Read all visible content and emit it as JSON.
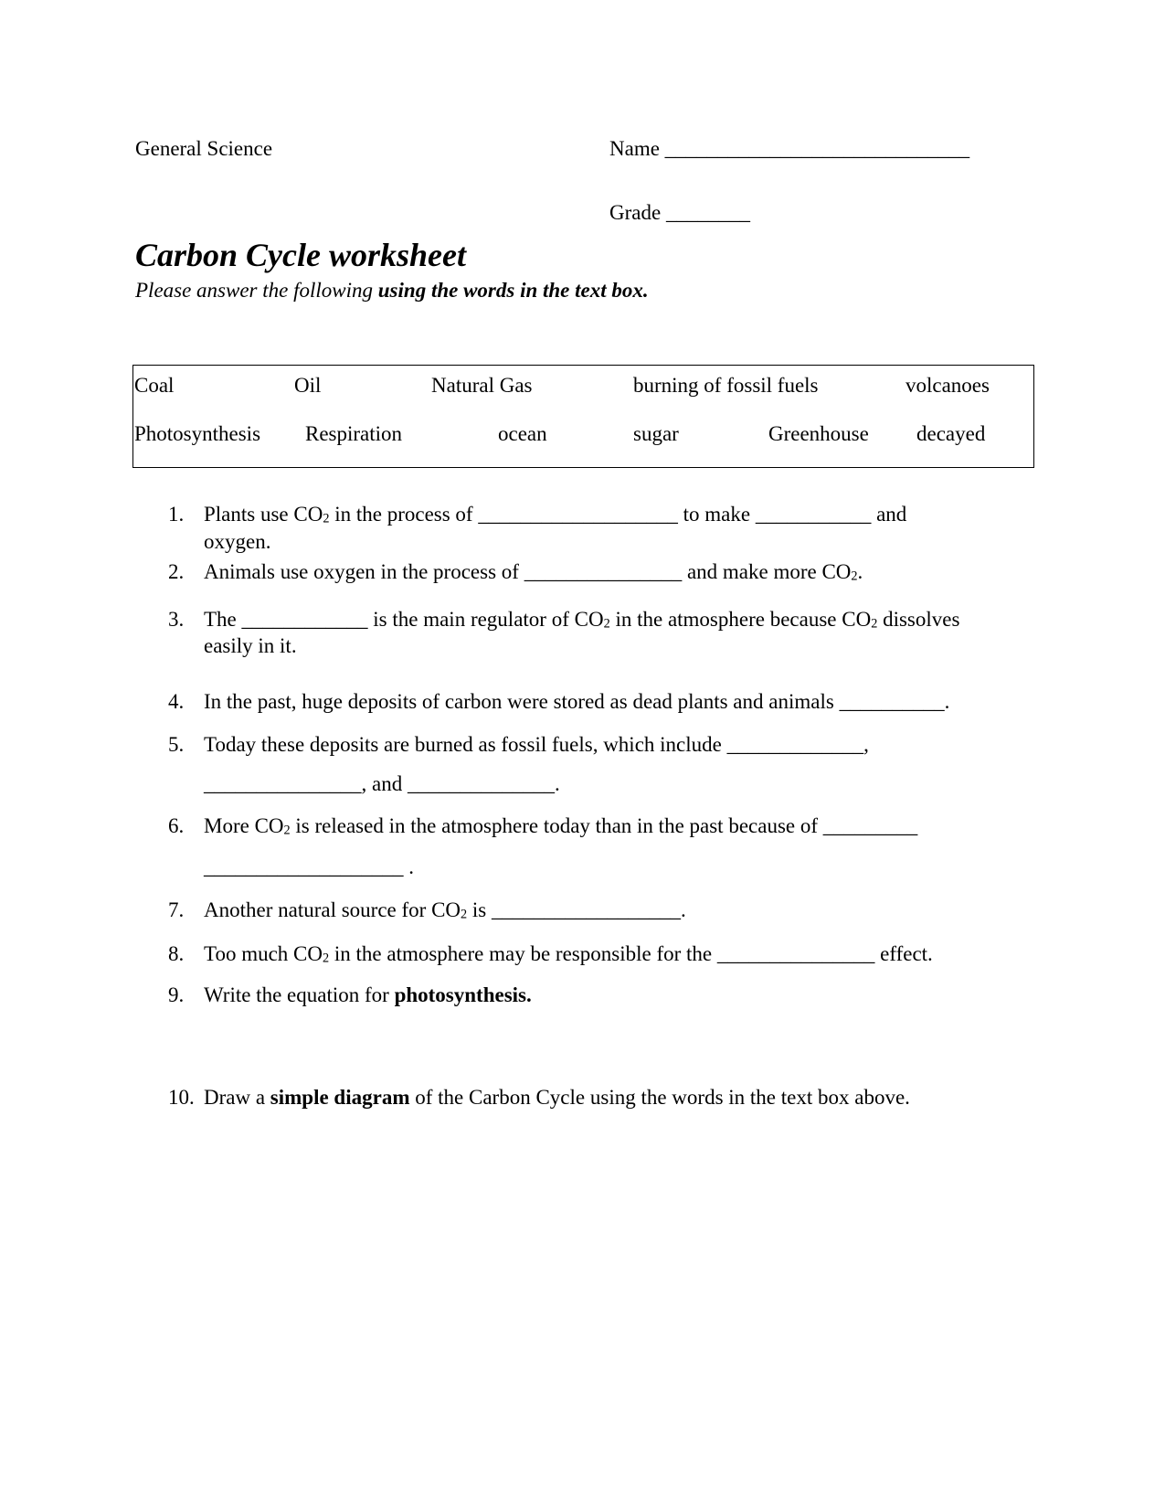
{
  "header": {
    "course": "General Science",
    "name_label": "Name",
    "name_blank": "_____________________________",
    "grade_label": "Grade",
    "grade_blank": "________"
  },
  "title": "Carbon Cycle worksheet",
  "subtitle": {
    "plain": "Please answer the following ",
    "bold": "using the words in the text box."
  },
  "word_box": {
    "row1": [
      "Coal",
      "Oil",
      "Natural Gas",
      "burning of fossil fuels",
      "volcanoes"
    ],
    "row2": [
      "Photosynthesis",
      "Respiration",
      "ocean",
      "sugar",
      "Greenhouse",
      "decayed"
    ]
  },
  "questions": {
    "q1": {
      "num": "1.",
      "a": "Plants use CO",
      "sub": "2",
      "b": " in the process of ",
      "blank1": "___________________",
      "c": " to make ",
      "blank2": "___________",
      "d": " and",
      "line2": "oxygen."
    },
    "q2": {
      "num": "2.",
      "a": "Animals use oxygen in the process of ",
      "blank": "_______________",
      "b": " and make more CO",
      "sub": "2",
      "c": "."
    },
    "q3": {
      "num": "3.",
      "a": "The ",
      "blank": "____________",
      "b": " is the main regulator of CO",
      "sub1": "2",
      "c": " in the atmosphere because CO",
      "sub2": "2",
      "d": " dissolves",
      "line2": "easily in it."
    },
    "q4": {
      "num": "4.",
      "a": "In the past, huge deposits of carbon were stored as dead plants and animals ",
      "blank": "__________",
      "b": "."
    },
    "q5": {
      "num": "5.",
      "a": "Today these deposits are burned as fossil fuels, which include ",
      "blank1": "_____________",
      "b": ",",
      "blank2": "_______________",
      "c": ", and ",
      "blank3": "______________",
      "d": "."
    },
    "q6": {
      "num": "6.",
      "a": "More CO",
      "sub": "2",
      "b": " is released in the atmosphere today than in the past because of ",
      "blank1": "_________",
      "blank2": "___________________",
      "c": " ."
    },
    "q7": {
      "num": "7.",
      "a": "Another natural source for CO",
      "sub": "2",
      "b": " is ",
      "blank": "__________________",
      "c": "."
    },
    "q8": {
      "num": "8.",
      "a": "Too much CO",
      "sub": "2",
      "b": " in the atmosphere may be responsible for the ",
      "blank": "_______________",
      "c": " effect."
    },
    "q9": {
      "num": "9.",
      "a": "Write the equation for ",
      "bold": "photosynthesis."
    },
    "q10": {
      "num": "10.",
      "a": "Draw a ",
      "bold": "simple diagram",
      "b": " of the Carbon Cycle using the words in the text box above."
    }
  }
}
